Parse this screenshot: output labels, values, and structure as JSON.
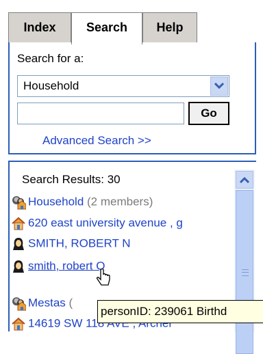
{
  "tabs": [
    {
      "label": "Index",
      "active": false
    },
    {
      "label": "Search",
      "active": true
    },
    {
      "label": "Help",
      "active": false
    }
  ],
  "search": {
    "label": "Search for a:",
    "selected_type": "Household",
    "input_value": "",
    "go_label": "Go",
    "advanced_link": "Advanced Search >>"
  },
  "results": {
    "header": "Search Results: 30",
    "items": [
      {
        "icon": "household-group-icon",
        "link": "Household",
        "extra": "(2 members)"
      },
      {
        "icon": "house-icon",
        "link": "620 east university avenue , g",
        "extra": ""
      },
      {
        "icon": "person-icon",
        "link": "SMITH, ROBERT N",
        "extra": ""
      },
      {
        "icon": "person-icon",
        "link": "smith, robert Q",
        "extra": ""
      },
      {
        "icon": "household-group-icon",
        "link": "Mestas",
        "extra": "("
      },
      {
        "icon": "house-icon",
        "link": "14619 SW 118 AVE , Archer",
        "extra": ""
      }
    ]
  },
  "tooltip": {
    "text": "personID: 239061 Birthd"
  },
  "colors": {
    "link": "#1f43c8",
    "panel_border": "#2b5eb8",
    "tab_bg": "#d6d3ce",
    "tooltip_bg": "#ffffe1"
  }
}
